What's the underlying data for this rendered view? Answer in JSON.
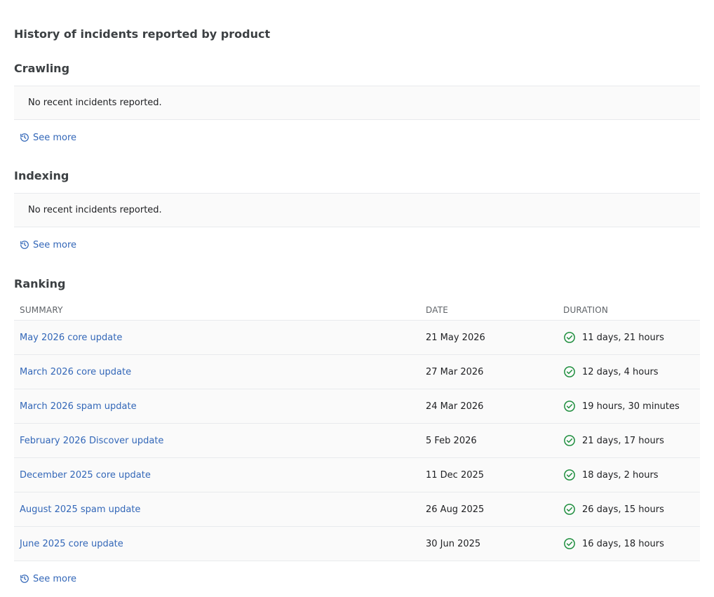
{
  "page": {
    "title": "History of incidents reported by product"
  },
  "sections": {
    "crawling": {
      "title": "Crawling",
      "empty_message": "No recent incidents reported.",
      "see_more": "See more"
    },
    "indexing": {
      "title": "Indexing",
      "empty_message": "No recent incidents reported.",
      "see_more": "See more"
    },
    "ranking": {
      "title": "Ranking",
      "columns": {
        "summary": "SUMMARY",
        "date": "DATE",
        "duration": "DURATION"
      },
      "rows": [
        {
          "summary": "May 2026 core update",
          "date": "21 May 2026",
          "duration": "11 days, 21 hours"
        },
        {
          "summary": "March 2026 core update",
          "date": "27 Mar 2026",
          "duration": "12 days, 4 hours"
        },
        {
          "summary": "March 2026 spam update",
          "date": "24 Mar 2026",
          "duration": "19 hours, 30 minutes"
        },
        {
          "summary": "February 2026 Discover update",
          "date": "5 Feb 2026",
          "duration": "21 days, 17 hours"
        },
        {
          "summary": "December 2025 core update",
          "date": "11 Dec 2025",
          "duration": "18 days, 2 hours"
        },
        {
          "summary": "August 2025 spam update",
          "date": "26 Aug 2025",
          "duration": "26 days, 15 hours"
        },
        {
          "summary": "June 2025 core update",
          "date": "30 Jun 2025",
          "duration": "16 days, 18 hours"
        }
      ],
      "see_more": "See more"
    }
  },
  "icons": {
    "see_more": "history-icon",
    "status": "check-circle-icon"
  },
  "colors": {
    "link": "#3367b8",
    "success": "#1e8e3e"
  }
}
